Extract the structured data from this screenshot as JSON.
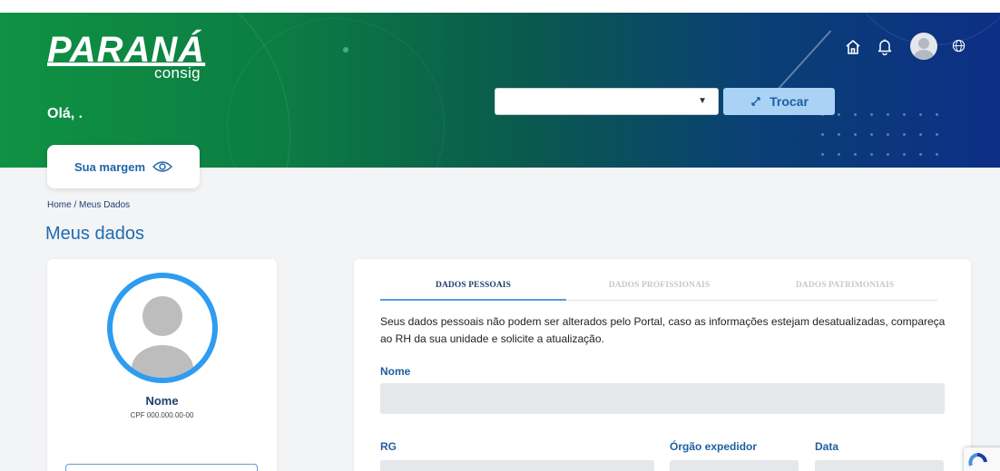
{
  "header": {
    "logo_text": "PARANÁ",
    "logo_sub": "consig",
    "greeting": "Olá, .",
    "org_select_value": "",
    "trocar_label": "Trocar"
  },
  "margin_card": {
    "label": "Sua margem"
  },
  "breadcrumb": {
    "home": "Home",
    "separator": " / ",
    "current": "Meus Dados"
  },
  "page_title": "Meus dados",
  "profile": {
    "name": "Nome",
    "cpf": "CPF 000.000.00-00"
  },
  "tabs": [
    {
      "label": "DADOS PESSOAIS",
      "active": true
    },
    {
      "label": "DADOS PROFISSIONAIS",
      "active": false
    },
    {
      "label": "DADOS PATRIMONIAIS",
      "active": false
    }
  ],
  "notice": "Seus dados pessoais não podem ser alterados pelo Portal, caso as informações estejam desatualizadas, compareça ao RH da sua unidade e solicite a atualização.",
  "fields": {
    "nome": {
      "label": "Nome",
      "value": ""
    },
    "rg": {
      "label": "RG",
      "value": ""
    },
    "orgao": {
      "label": "Órgão expedidor",
      "value": ""
    },
    "data": {
      "label": "Data",
      "value": ""
    }
  },
  "colors": {
    "header_green": "#0f9243",
    "header_blue": "#0d2f86",
    "accent_blue": "#1d6cb0",
    "trocar_bg": "#a9d2f4",
    "avatar_ring": "#2e9cf0"
  },
  "icons": [
    "home-icon",
    "bell-icon",
    "user-avatar",
    "globe-icon",
    "eye-icon",
    "swap-icon",
    "chevron-down-icon",
    "recaptcha-icon"
  ]
}
